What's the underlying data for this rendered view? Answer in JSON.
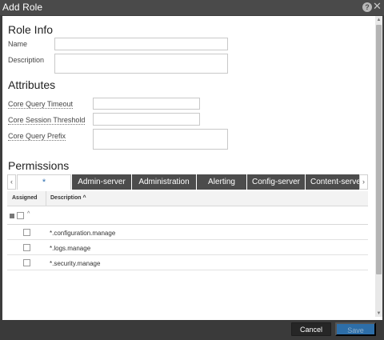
{
  "window": {
    "title": "Add Role",
    "help_glyph": "?",
    "close_glyph": "✕"
  },
  "role_info": {
    "heading": "Role Info",
    "name_label": "Name",
    "name_value": "",
    "description_label": "Description",
    "description_value": ""
  },
  "attributes": {
    "heading": "Attributes",
    "core_query_timeout_label": "Core Query Timeout",
    "core_query_timeout_value": "",
    "core_session_threshold_label": "Core Session Threshold",
    "core_session_threshold_value": "",
    "core_query_prefix_label": "Core Query Prefix",
    "core_query_prefix_value": ""
  },
  "permissions": {
    "heading": "Permissions",
    "tab_prev_glyph": "‹",
    "tab_next_glyph": "›",
    "tabs": [
      {
        "label": "*",
        "active": true
      },
      {
        "label": "Admin-server",
        "active": false
      },
      {
        "label": "Administration",
        "active": false
      },
      {
        "label": "Alerting",
        "active": false
      },
      {
        "label": "Config-server",
        "active": false
      },
      {
        "label": "Content-server",
        "active": false
      }
    ],
    "columns": {
      "assigned": "Assigned",
      "description": "Description ^"
    },
    "select_all_glyph": "^",
    "rows": [
      {
        "description": "*.configuration.manage",
        "assigned": false
      },
      {
        "description": "*.logs.manage",
        "assigned": false
      },
      {
        "description": "*.security.manage",
        "assigned": false
      }
    ]
  },
  "footer": {
    "cancel_label": "Cancel",
    "save_label": "Save"
  },
  "colors": {
    "titlebar": "#4a4a4a",
    "active_tab_text": "#2f6fb0",
    "tab_background": "#4c4c4c",
    "save_button": "#2d6ea8"
  }
}
